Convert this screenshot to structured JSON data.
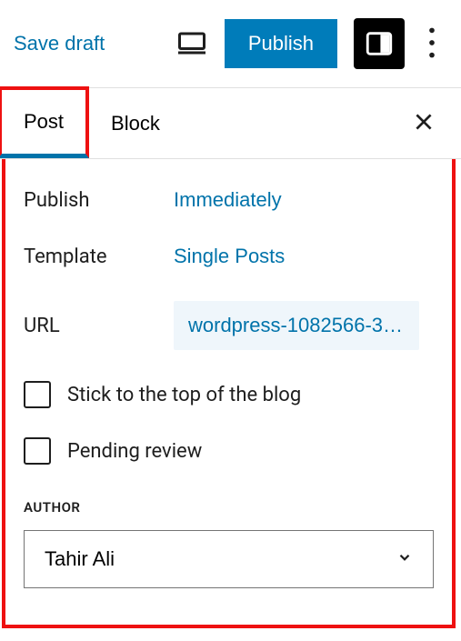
{
  "toolbar": {
    "save_draft": "Save draft",
    "publish": "Publish"
  },
  "tabs": {
    "post": "Post",
    "block": "Block"
  },
  "settings": {
    "publish_label": "Publish",
    "publish_value": "Immediately",
    "template_label": "Template",
    "template_value": "Single Posts",
    "url_label": "URL",
    "url_value": "wordpress-1082566-3…"
  },
  "checkboxes": {
    "sticky": "Stick to the top of the blog",
    "pending": "Pending review"
  },
  "author": {
    "heading": "AUTHOR",
    "value": "Tahir Ali"
  }
}
